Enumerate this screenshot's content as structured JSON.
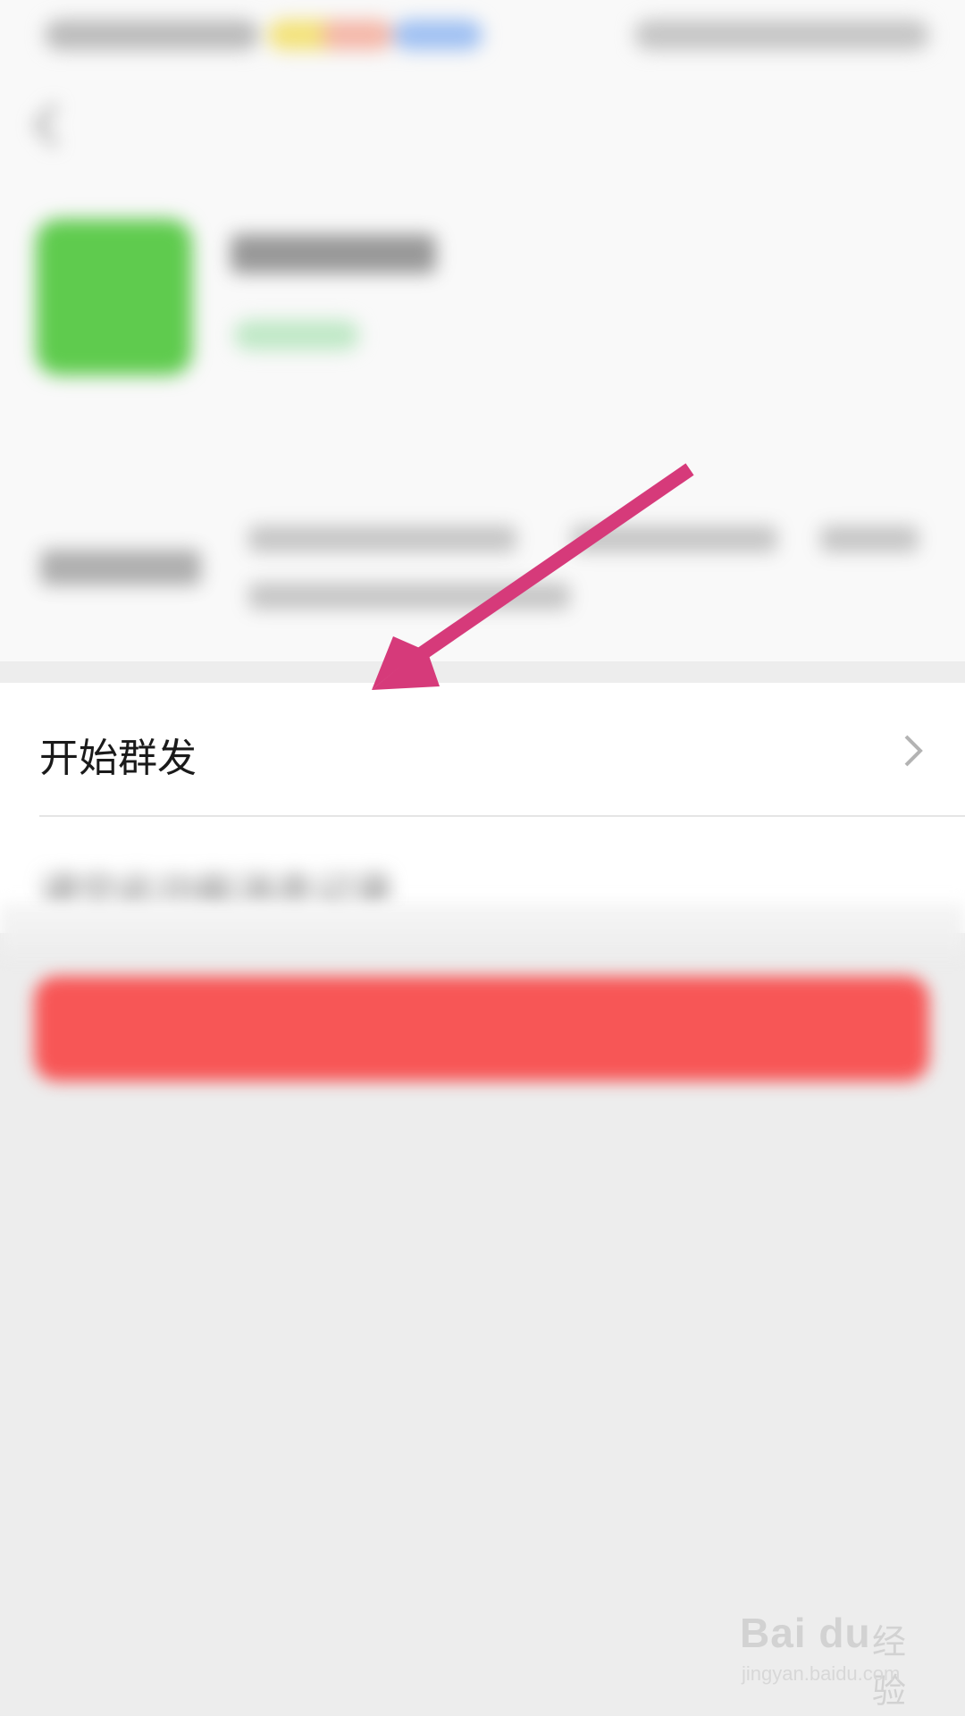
{
  "list": {
    "start_broadcast_label": "开始群发",
    "clear_label": "请空此功能消息记录"
  },
  "primary_button": {
    "label": ""
  },
  "watermark": {
    "brand": "Bai du",
    "brand_cn": "经验",
    "url": "jingyan.baidu.com"
  },
  "colors": {
    "arrow": "#d63a7a",
    "button": "#f75656",
    "app_icon": "#5fcb4e"
  }
}
